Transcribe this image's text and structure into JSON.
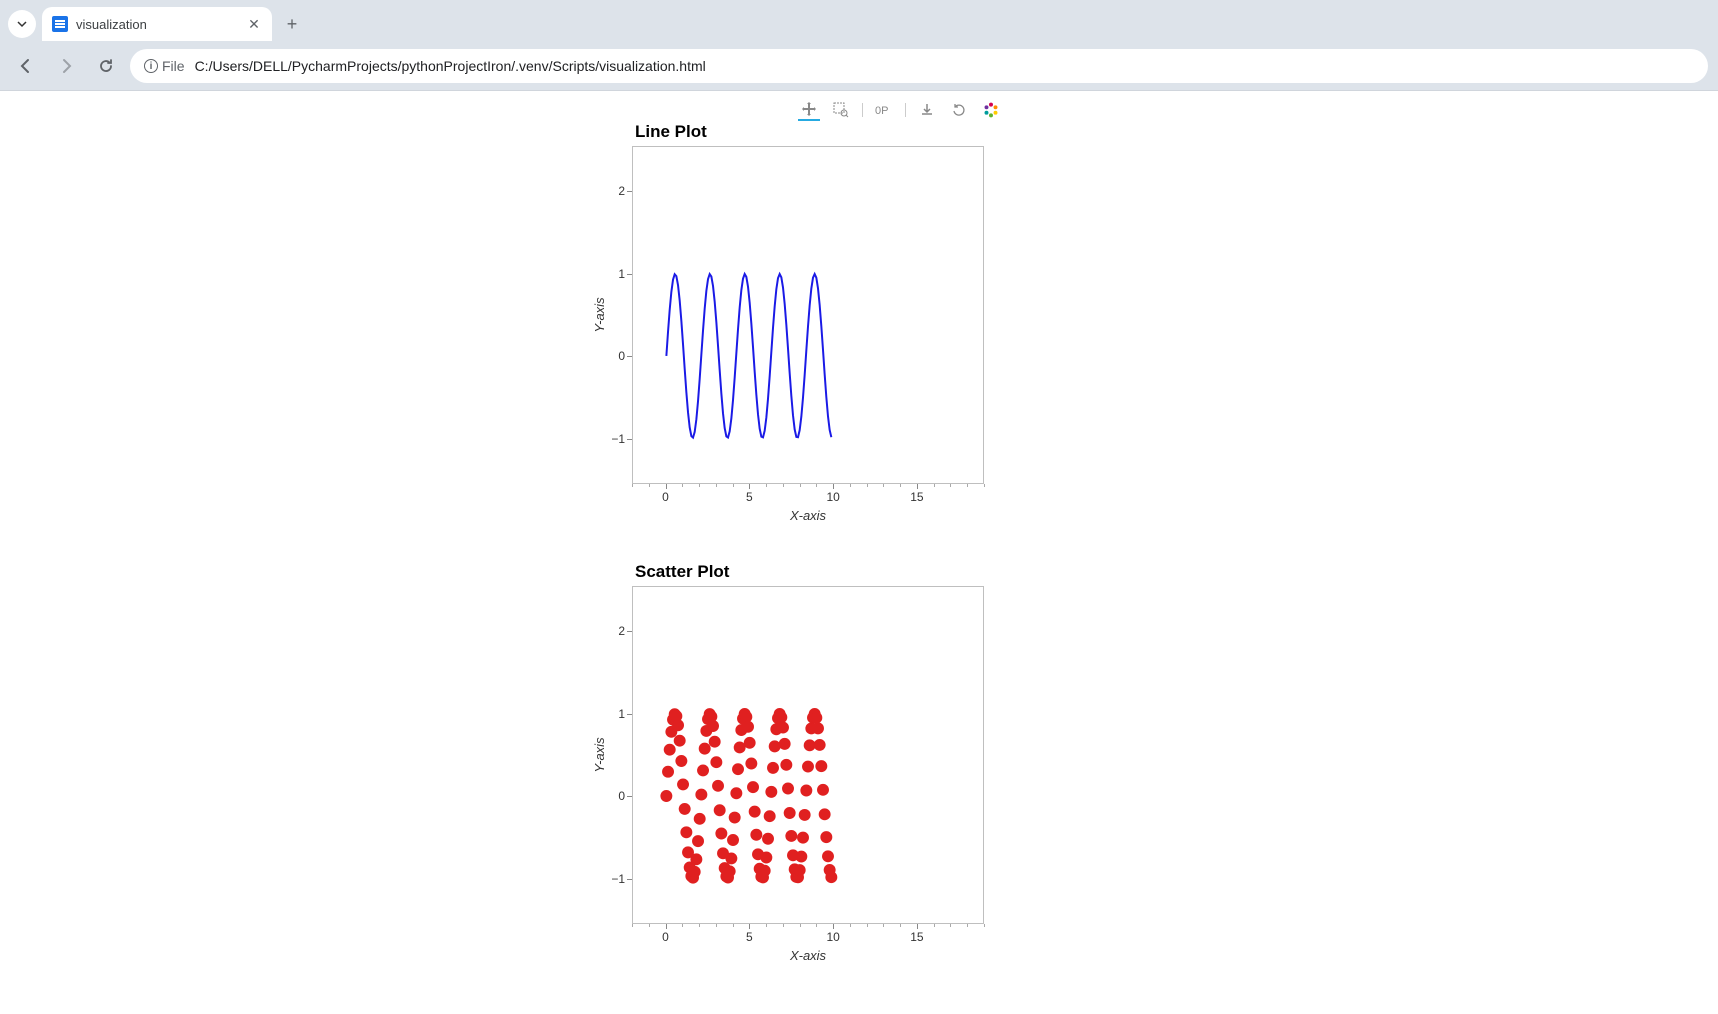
{
  "browser": {
    "tab_title": "visualization",
    "url": "C:/Users/DELL/PycharmProjects/pythonProjectIron/.venv/Scripts/visualization.html",
    "file_label": "File"
  },
  "toolbar_tools": [
    "pan",
    "box-zoom",
    "wheel-zoom",
    "save",
    "reset"
  ],
  "chart_data": [
    {
      "type": "line",
      "title": "Line Plot",
      "xlabel": "X-axis",
      "ylabel": "Y-axis",
      "xlim": [
        -2,
        19
      ],
      "ylim": [
        -1.55,
        2.55
      ],
      "xticks": [
        0,
        5,
        10,
        15
      ],
      "yticks": [
        -1,
        0,
        1,
        2
      ],
      "color": "#1a1ae6",
      "data": {
        "x": [
          0,
          0.1,
          0.2,
          0.3,
          0.4,
          0.5,
          0.6,
          0.7,
          0.8,
          0.9,
          1.0,
          1.1,
          1.2,
          1.3,
          1.4,
          1.5,
          1.6,
          1.7,
          1.8,
          1.9,
          2.0,
          2.1,
          2.2,
          2.3,
          2.4,
          2.5,
          2.6,
          2.7,
          2.8,
          2.9,
          3.0,
          3.1,
          3.2,
          3.3,
          3.4,
          3.5,
          3.6,
          3.7,
          3.8,
          3.9,
          4.0,
          4.1,
          4.2,
          4.3,
          4.4,
          4.5,
          4.6,
          4.7,
          4.8,
          4.9,
          5.0,
          5.1,
          5.2,
          5.3,
          5.4,
          5.5,
          5.6,
          5.7,
          5.8,
          5.9,
          6.0,
          6.1,
          6.2,
          6.3,
          6.4,
          6.5,
          6.6,
          6.7,
          6.8,
          6.9,
          7.0,
          7.1,
          7.2,
          7.3,
          7.4,
          7.5,
          7.6,
          7.7,
          7.8,
          7.9,
          8.0,
          8.1,
          8.2,
          8.3,
          8.4,
          8.5,
          8.6,
          8.7,
          8.8,
          8.9,
          9.0,
          9.1,
          9.2,
          9.3,
          9.4,
          9.5,
          9.6,
          9.7,
          9.8,
          9.9
        ],
        "y": [
          0,
          0.296,
          0.565,
          0.783,
          0.932,
          0.997,
          0.974,
          0.863,
          0.675,
          0.427,
          0.141,
          -0.158,
          -0.443,
          -0.688,
          -0.872,
          -0.978,
          -0.996,
          -0.926,
          -0.773,
          -0.551,
          -0.279,
          0.017,
          0.312,
          0.578,
          0.794,
          0.938,
          0.999,
          0.969,
          0.854,
          0.662,
          0.412,
          0.124,
          -0.174,
          -0.458,
          -0.7,
          -0.88,
          -0.981,
          -0.995,
          -0.919,
          -0.762,
          -0.537,
          -0.263,
          0.033,
          0.327,
          0.592,
          0.804,
          0.944,
          1.0,
          0.965,
          0.845,
          0.649,
          0.396,
          0.108,
          -0.191,
          -0.473,
          -0.712,
          -0.888,
          -0.985,
          -0.993,
          -0.912,
          -0.751,
          -0.522,
          -0.247,
          0.05,
          0.343,
          0.605,
          0.814,
          0.95,
          1.0,
          0.96,
          0.835,
          0.636,
          0.38,
          0.091,
          -0.208,
          -0.488,
          -0.724,
          -0.896,
          -0.988,
          -0.992,
          -0.905,
          -0.739,
          -0.508,
          -0.231,
          0.067,
          0.359,
          0.618,
          0.824,
          0.955,
          1.0,
          0.955,
          0.825,
          0.623,
          0.364,
          0.075,
          -0.224,
          -0.502,
          -0.736,
          -0.903,
          -0.991
        ]
      }
    },
    {
      "type": "scatter",
      "title": "Scatter Plot",
      "xlabel": "X-axis",
      "ylabel": "Y-axis",
      "xlim": [
        -2,
        19
      ],
      "ylim": [
        -1.55,
        2.55
      ],
      "xticks": [
        0,
        5,
        10,
        15
      ],
      "yticks": [
        -1,
        0,
        1,
        2
      ],
      "color": "#e02020",
      "marker_size": 6,
      "data": {
        "x": [
          0,
          0.1,
          0.2,
          0.3,
          0.4,
          0.5,
          0.6,
          0.7,
          0.8,
          0.9,
          1.0,
          1.1,
          1.2,
          1.3,
          1.4,
          1.5,
          1.6,
          1.7,
          1.8,
          1.9,
          2.0,
          2.1,
          2.2,
          2.3,
          2.4,
          2.5,
          2.6,
          2.7,
          2.8,
          2.9,
          3.0,
          3.1,
          3.2,
          3.3,
          3.4,
          3.5,
          3.6,
          3.7,
          3.8,
          3.9,
          4.0,
          4.1,
          4.2,
          4.3,
          4.4,
          4.5,
          4.6,
          4.7,
          4.8,
          4.9,
          5.0,
          5.1,
          5.2,
          5.3,
          5.4,
          5.5,
          5.6,
          5.7,
          5.8,
          5.9,
          6.0,
          6.1,
          6.2,
          6.3,
          6.4,
          6.5,
          6.6,
          6.7,
          6.8,
          6.9,
          7.0,
          7.1,
          7.2,
          7.3,
          7.4,
          7.5,
          7.6,
          7.7,
          7.8,
          7.9,
          8.0,
          8.1,
          8.2,
          8.3,
          8.4,
          8.5,
          8.6,
          8.7,
          8.8,
          8.9,
          9.0,
          9.1,
          9.2,
          9.3,
          9.4,
          9.5,
          9.6,
          9.7,
          9.8,
          9.9
        ],
        "y": [
          0,
          0.296,
          0.565,
          0.783,
          0.932,
          0.997,
          0.974,
          0.863,
          0.675,
          0.427,
          0.141,
          -0.158,
          -0.443,
          -0.688,
          -0.872,
          -0.978,
          -0.996,
          -0.926,
          -0.773,
          -0.551,
          -0.279,
          0.017,
          0.312,
          0.578,
          0.794,
          0.938,
          0.999,
          0.969,
          0.854,
          0.662,
          0.412,
          0.124,
          -0.174,
          -0.458,
          -0.7,
          -0.88,
          -0.981,
          -0.995,
          -0.919,
          -0.762,
          -0.537,
          -0.263,
          0.033,
          0.327,
          0.592,
          0.804,
          0.944,
          1.0,
          0.965,
          0.845,
          0.649,
          0.396,
          0.108,
          -0.191,
          -0.473,
          -0.712,
          -0.888,
          -0.985,
          -0.993,
          -0.912,
          -0.751,
          -0.522,
          -0.247,
          0.05,
          0.343,
          0.605,
          0.814,
          0.95,
          1.0,
          0.96,
          0.835,
          0.636,
          0.38,
          0.091,
          -0.208,
          -0.488,
          -0.724,
          -0.896,
          -0.988,
          -0.992,
          -0.905,
          -0.739,
          -0.508,
          -0.231,
          0.067,
          0.359,
          0.618,
          0.824,
          0.955,
          1.0,
          0.955,
          0.825,
          0.623,
          0.364,
          0.075,
          -0.224,
          -0.502,
          -0.736,
          -0.903,
          -0.991
        ]
      }
    }
  ]
}
